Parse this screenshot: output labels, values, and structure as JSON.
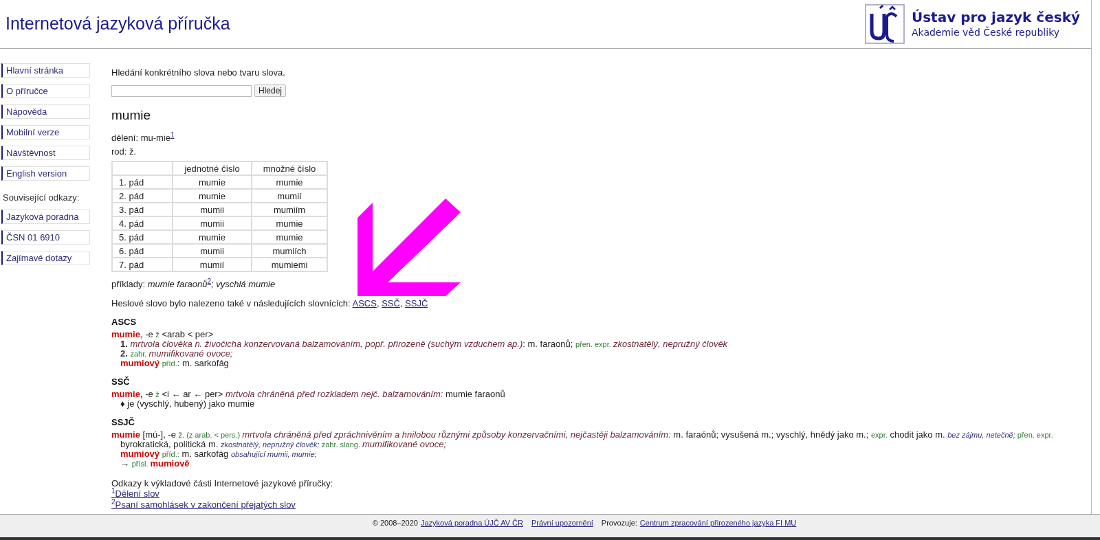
{
  "header": {
    "title": "Internetová jazyková příručka",
    "institute": "Ústav pro jazyk český",
    "academy": "Akademie věd České republiky"
  },
  "sidebar": {
    "items": [
      {
        "label": "Hlavní stránka"
      },
      {
        "label": "O příručce"
      },
      {
        "label": "Nápověda"
      },
      {
        "label": "Mobilní verze"
      },
      {
        "label": "Návštěvnost"
      },
      {
        "label": "English version"
      }
    ],
    "related_heading": "Související odkazy:",
    "related_items": [
      {
        "label": "Jazyková poradna"
      },
      {
        "label": "ČSN 01 6910"
      },
      {
        "label": "Zajímavé dotazy"
      }
    ]
  },
  "search": {
    "intro": "Hledání konkrétního slova nebo tvaru slova.",
    "button": "Hledej"
  },
  "headword": "mumie",
  "division": {
    "label": "dělení: mu-mie",
    "footnote": "1"
  },
  "gender": "rod: ž.",
  "table": {
    "columns": [
      "jednotné číslo",
      "množné číslo"
    ],
    "rows": [
      {
        "case": "1. pád",
        "singular": "mumie",
        "plural": "mumie"
      },
      {
        "case": "2. pád",
        "singular": "mumie",
        "plural": "mumií"
      },
      {
        "case": "3. pád",
        "singular": "mumii",
        "plural": "mumiím"
      },
      {
        "case": "4. pád",
        "singular": "mumii",
        "plural": "mumie"
      },
      {
        "case": "5. pád",
        "singular": "mumie",
        "plural": "mumie"
      },
      {
        "case": "6. pád",
        "singular": "mumii",
        "plural": "mumiích"
      },
      {
        "case": "7. pád",
        "singular": "mumií",
        "plural": "mumiemi"
      }
    ]
  },
  "examples": {
    "label": "příklady: ",
    "part1": "mumie faraonů",
    "footnote": "2",
    "part2": "; vyschlá mumie"
  },
  "found_in": {
    "text": "Heslové slovo bylo nalezeno také v následujících slovnících: ",
    "separator": ", ",
    "links": [
      "ASCS",
      "SSČ",
      "SSJČ"
    ]
  },
  "dictionaries": [
    {
      "name": "ASCS",
      "lines": [
        {
          "kind": "main",
          "segments": [
            {
              "kind": "head",
              "text": "mumie"
            },
            {
              "kind": "plain",
              "text": ", -e "
            },
            {
              "kind": "qual",
              "text": "ž"
            },
            {
              "kind": "plain",
              "text": " <arab < per>"
            }
          ]
        },
        {
          "kind": "sub",
          "segments": [
            {
              "kind": "num",
              "text": "1. "
            },
            {
              "kind": "def",
              "text": "mrtvola člověka n. živočicha konzervovaná balzamováním, popř. přirozeně (suchým vzduchem ap.)"
            },
            {
              "kind": "plain",
              "text": ": m. faraonů; "
            },
            {
              "kind": "qual",
              "text": "přen. expr. "
            },
            {
              "kind": "def",
              "text": "zkostnatělý, nepružný člověk"
            }
          ]
        },
        {
          "kind": "sub",
          "segments": [
            {
              "kind": "num",
              "text": "2. "
            },
            {
              "kind": "qual",
              "text": "zahr. "
            },
            {
              "kind": "def",
              "text": "mumifikované ovoce;"
            }
          ]
        },
        {
          "kind": "sub",
          "segments": [
            {
              "kind": "head",
              "text": "mumiový "
            },
            {
              "kind": "qual",
              "text": "příd."
            },
            {
              "kind": "plain",
              "text": ": m. sarkofág"
            }
          ]
        }
      ]
    },
    {
      "name": "SSČ",
      "lines": [
        {
          "kind": "main",
          "segments": [
            {
              "kind": "head",
              "text": "mumie,"
            },
            {
              "kind": "plain",
              "text": " -e "
            },
            {
              "kind": "qual",
              "text": "ž"
            },
            {
              "kind": "plain",
              "text": " <i ← ar ← per> "
            },
            {
              "kind": "def",
              "text": "mrtvola chráněná před rozkladem nejč. balzamováním:"
            },
            {
              "kind": "plain",
              "text": " mumie faraonů"
            }
          ]
        },
        {
          "kind": "sub",
          "segments": [
            {
              "kind": "plain",
              "text": "♦ je (vyschlý, hubený) jako mumie"
            }
          ]
        }
      ]
    },
    {
      "name": "SSJČ",
      "lines": [
        {
          "kind": "main",
          "segments": [
            {
              "kind": "head",
              "text": "mumie"
            },
            {
              "kind": "plain",
              "text": " [mú-], -e "
            },
            {
              "kind": "qual",
              "text": "ž. (z arab. < pers.) "
            },
            {
              "kind": "def",
              "text": "mrtvola chráněná před zpráchnivěním a hnilobou různými způsoby konzervačními, nejčastěji balzamováním:"
            },
            {
              "kind": "plain",
              "text": " m. faraónů; vysušená m.; vyschlý, hnědý jako m.; "
            },
            {
              "kind": "qual",
              "text": "expr."
            },
            {
              "kind": "plain",
              "text": " chodit jako m. "
            },
            {
              "kind": "note",
              "text": "bez zájmu, netečně;"
            },
            {
              "kind": "qual",
              "text": " přen. expr."
            }
          ]
        },
        {
          "kind": "sub",
          "segments": [
            {
              "kind": "plain",
              "text": "byrokratická, politická m. "
            },
            {
              "kind": "note",
              "text": "zkostnatělý, nepružný člověk;"
            },
            {
              "kind": "qual",
              "text": " zahr. slang. "
            },
            {
              "kind": "def",
              "text": "mumifikované ovoce;"
            }
          ]
        },
        {
          "kind": "sub",
          "segments": [
            {
              "kind": "head",
              "text": "mumiový "
            },
            {
              "kind": "qual",
              "text": "příd.:"
            },
            {
              "kind": "plain",
              "text": " m. sarkofág "
            },
            {
              "kind": "note",
              "text": "obsahující mumii, mumie;"
            }
          ]
        },
        {
          "kind": "sub",
          "segments": [
            {
              "kind": "plain",
              "text": "→ "
            },
            {
              "kind": "qual",
              "text": "přísl. "
            },
            {
              "kind": "head",
              "text": "mumiově"
            }
          ]
        }
      ]
    }
  ],
  "references": {
    "heading": "Odkazy k výkladové části Internetové jazykové příručky:",
    "items": [
      {
        "number": "1",
        "label": "Dělení slov"
      },
      {
        "number": "2",
        "label": "Psaní samohlásek v zakončení přejatých slov"
      }
    ]
  },
  "footer": [
    {
      "kind": "text",
      "text": "© 2008–2020"
    },
    {
      "kind": "link",
      "text": "Jazyková poradna ÚJČ AV ČR"
    },
    {
      "kind": "link",
      "text": "Právní upozornění"
    },
    {
      "kind": "text",
      "text": "Provozuje:"
    },
    {
      "kind": "link",
      "text": "Centrum zpracování přirozeného jazyka FI MU"
    }
  ]
}
